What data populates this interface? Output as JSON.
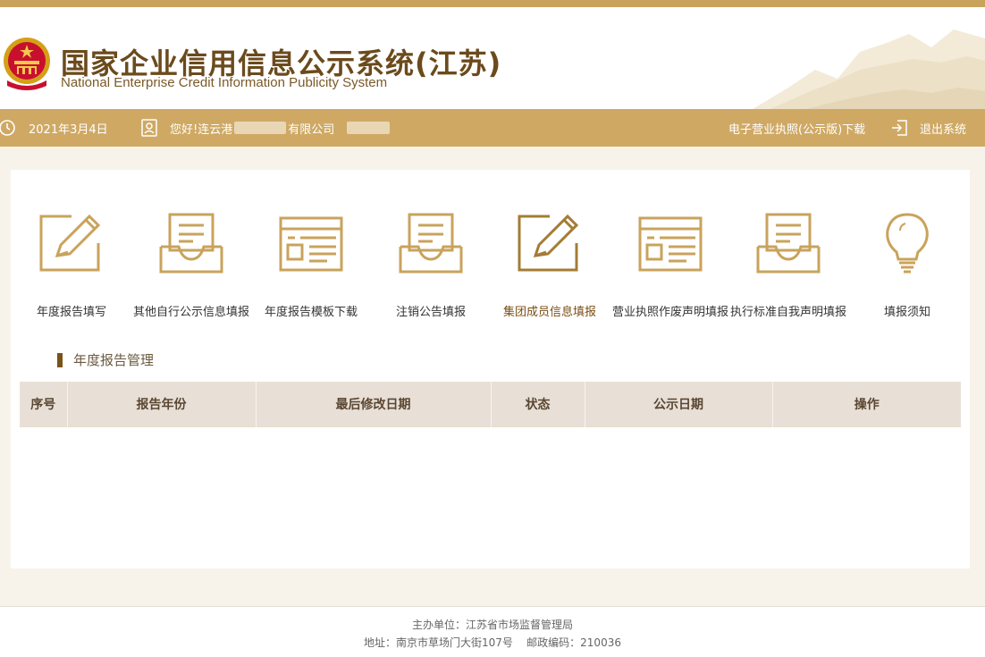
{
  "header": {
    "title_cn": "国家企业信用信息公示系统(江苏)",
    "title_en": "National Enterprise Credit Information Publicity System"
  },
  "bar": {
    "date": "2021年3月4日",
    "greeting_prefix": "您好!连云港",
    "company_suffix": "有限公司",
    "license_download": "电子营业执照(公示版)下载",
    "logout": "退出系统"
  },
  "functions": [
    {
      "label": "年度报告填写",
      "icon": "edit-pencil-icon"
    },
    {
      "label": "其他自行公示信息填报",
      "icon": "inbox-tray-icon"
    },
    {
      "label": "年度报告模板下载",
      "icon": "template-window-icon"
    },
    {
      "label": "注销公告填报",
      "icon": "inbox-tray-icon"
    },
    {
      "label": "集团成员信息填报",
      "icon": "edit-pencil-icon"
    },
    {
      "label": "营业执照作废声明填报",
      "icon": "template-window-icon"
    },
    {
      "label": "执行标准自我声明填报",
      "icon": "inbox-tray-icon"
    },
    {
      "label": "填报须知",
      "icon": "lightbulb-icon"
    }
  ],
  "section_title": "年度报告管理",
  "table": {
    "headers": [
      "序号",
      "报告年份",
      "最后修改日期",
      "状态",
      "公示日期",
      "操作"
    ],
    "rows": []
  },
  "footer": {
    "line1": "主办单位：江苏省市场监督管理局",
    "line2": "地址：南京市草场门大街107号    邮政编码：210036"
  },
  "colors": {
    "gold": "#cfa964",
    "dark_brown": "#6b4a1c",
    "icon_light": "#c9a35c",
    "icon_dark": "#a57c34"
  }
}
